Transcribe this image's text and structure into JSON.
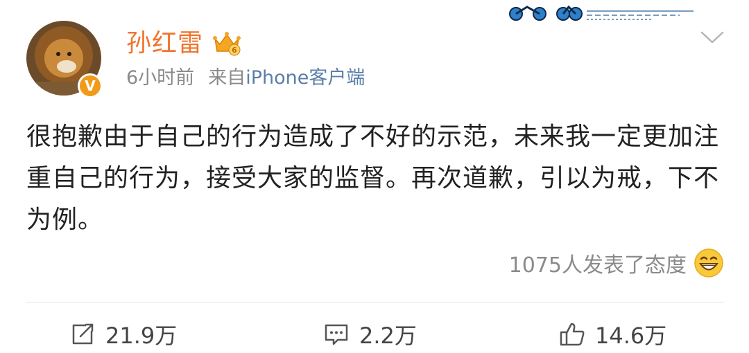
{
  "post": {
    "author": "孙红雷",
    "time": "6小时前",
    "source_prefix": "来自",
    "source_device": "iPhone客户端",
    "content": "很抱歉由于自己的行为造成了不好的示范，未来我一定更加注重自己的行为，接受大家的监督。再次道歉，引以为戒，下不为例。",
    "reactions_text": "1075人发表了态度",
    "verified_badge": "V",
    "level_badge": "6"
  },
  "actions": {
    "repost": {
      "icon": "repost-icon",
      "count": "21.9万"
    },
    "comment": {
      "icon": "comment-icon",
      "count": "2.2万"
    },
    "like": {
      "icon": "thumbs-up-icon",
      "count": "14.6万"
    }
  },
  "icons": {
    "menu": "chevron-down-icon",
    "member": "crown-icon",
    "reaction": "grinning-face-icon"
  },
  "colors": {
    "username": "#f0742c",
    "device_link": "#5a7ea8",
    "meta": "#8a8a8a",
    "body_text": "#222222",
    "verified_badge": "#f09b1a"
  }
}
